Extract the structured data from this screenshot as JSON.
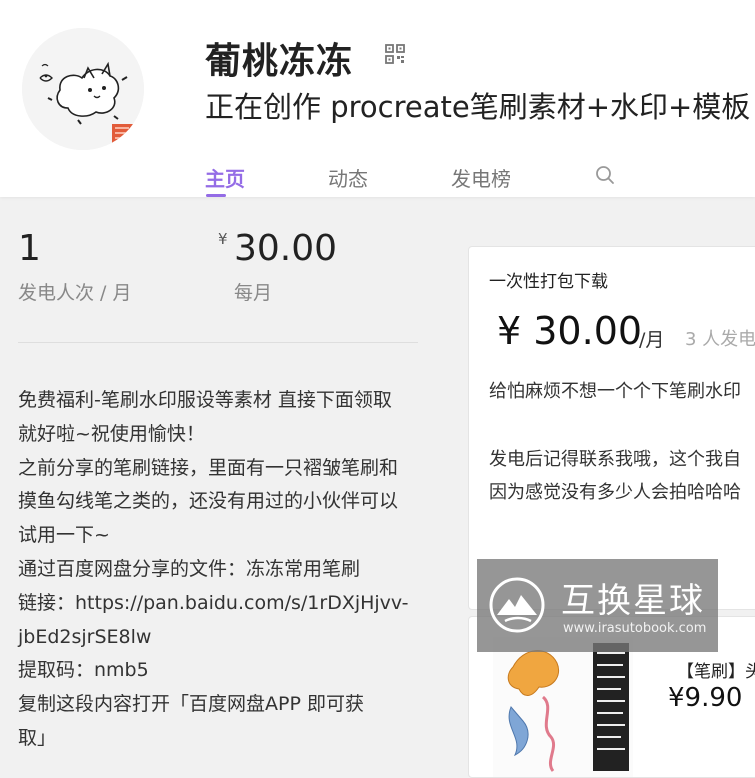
{
  "profile": {
    "name": "葡桃冻冻",
    "tagline": "正在创作 procreate笔刷素材+水印+模板"
  },
  "tabs": [
    {
      "label": "主页",
      "active": true
    },
    {
      "label": "动态",
      "active": false
    },
    {
      "label": "发电榜",
      "active": false
    }
  ],
  "stats": {
    "sponsors_value": "1",
    "sponsors_label": "发电人次 / 月",
    "currency_symbol": "¥",
    "monthly_value": "30.00",
    "monthly_label": "每月"
  },
  "description": [
    "免费福利-笔刷水印服设等素材 直接下面领取",
    "就好啦~祝使用愉快！",
    "之前分享的笔刷链接，里面有一只褶皱笔刷和",
    "摸鱼勾线笔之类的，还没有用过的小伙伴可以",
    "试用一下~",
    "通过百度网盘分享的文件：冻冻常用笔刷",
    "链接：https://pan.baidu.com/s/1rDXjHjvv-",
    "jbEd2sjrSE8lw",
    "提取码：nmb5",
    "复制这段内容打开「百度网盘APP 即可获",
    "取」"
  ],
  "plan_card": {
    "title": "一次性打包下载",
    "price": "¥ 30.00",
    "unit": "/月",
    "count": "3 人发电",
    "line1": "给怕麻烦不想一个个下笔刷水印",
    "line2": "发电后记得联系我哦，这个我自",
    "line3": "因为感觉没有多少人会拍哈哈哈"
  },
  "product_card": {
    "title": "【笔刷】头",
    "price": "¥9.90"
  },
  "watermark": {
    "title": "互换星球",
    "url": "www.irasutobook.com"
  },
  "colors": {
    "accent": "#946ce6",
    "background": "#f1f1f1"
  }
}
